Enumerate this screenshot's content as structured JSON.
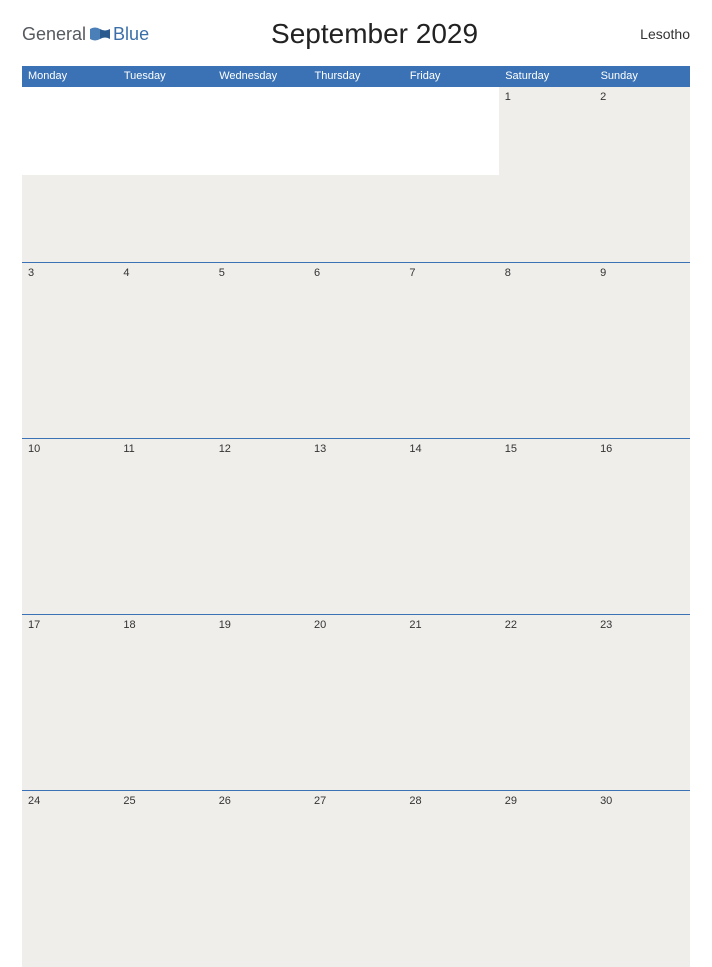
{
  "logo": {
    "general": "General",
    "blue": "Blue"
  },
  "title": "September 2029",
  "region": "Lesotho",
  "daysOfWeek": [
    "Monday",
    "Tuesday",
    "Wednesday",
    "Thursday",
    "Friday",
    "Saturday",
    "Sunday"
  ],
  "weeks": [
    [
      "",
      "",
      "",
      "",
      "",
      "1",
      "2"
    ],
    [
      "3",
      "4",
      "5",
      "6",
      "7",
      "8",
      "9"
    ],
    [
      "10",
      "11",
      "12",
      "13",
      "14",
      "15",
      "16"
    ],
    [
      "17",
      "18",
      "19",
      "20",
      "21",
      "22",
      "23"
    ],
    [
      "24",
      "25",
      "26",
      "27",
      "28",
      "29",
      "30"
    ]
  ]
}
